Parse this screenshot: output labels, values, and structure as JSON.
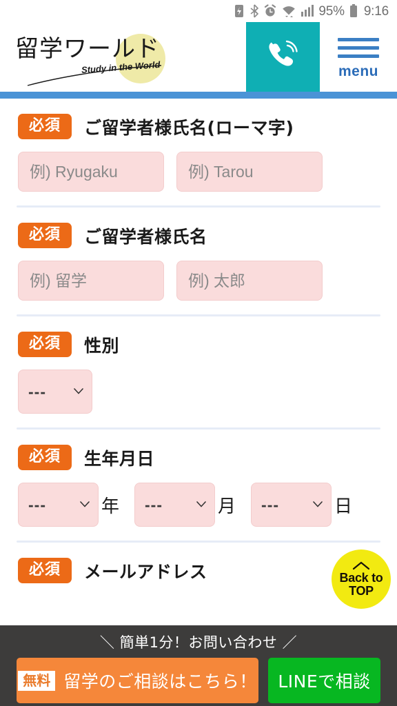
{
  "statusbar": {
    "icons": [
      "battery-saver-icon",
      "bluetooth-icon",
      "alarm-icon",
      "wifi-icon",
      "cellular-signal-icon"
    ],
    "battery_percent": "95%",
    "battery_icon": "battery-icon",
    "time": "9:16"
  },
  "header": {
    "logo_main": "留学ワールド",
    "logo_sub": "Study in the World",
    "phone_icon": "phone-call-icon",
    "menu_icon": "hamburger-menu-icon",
    "menu_label": "menu",
    "accent_teal": "#0fafb4",
    "accent_blue": "#4a93d6",
    "logo_circle_color": "#efeaa8"
  },
  "form": {
    "required_badge": "必須",
    "fields": [
      {
        "id": "name-romaji",
        "title": "ご留学者様氏名(ローマ字)",
        "type": "text-pair",
        "inputs": [
          {
            "name": "last-name-romaji",
            "placeholder": "例) Ryugaku",
            "value": ""
          },
          {
            "name": "first-name-romaji",
            "placeholder": "例) Tarou",
            "value": ""
          }
        ]
      },
      {
        "id": "name-kanji",
        "title": "ご留学者様氏名",
        "type": "text-pair",
        "inputs": [
          {
            "name": "last-name-kanji",
            "placeholder": "例) 留学",
            "value": ""
          },
          {
            "name": "first-name-kanji",
            "placeholder": "例) 太郎",
            "value": ""
          }
        ]
      },
      {
        "id": "gender",
        "title": "性別",
        "type": "select",
        "selects": [
          {
            "name": "gender-select",
            "value": "---",
            "unit": ""
          }
        ]
      },
      {
        "id": "birthdate",
        "title": "生年月日",
        "type": "select-date",
        "selects": [
          {
            "name": "birth-year-select",
            "value": "---",
            "unit": "年"
          },
          {
            "name": "birth-month-select",
            "value": "---",
            "unit": "月"
          },
          {
            "name": "birth-day-select",
            "value": "---",
            "unit": "日"
          }
        ]
      },
      {
        "id": "email",
        "title": "メールアドレス",
        "type": "text",
        "inputs": []
      }
    ],
    "input_bg": "#fadcdc",
    "badge_color": "#ec6a17"
  },
  "back_to_top": {
    "chevron_icon": "chevron-up-icon",
    "line1": "Back to",
    "line2": "TOP",
    "color": "#f2ea11"
  },
  "bottom_bar": {
    "tagline": "＼ 簡単1分！お問い合わせ ／",
    "consult_badge": "無料",
    "consult_label": "留学のご相談はこちら！",
    "line_label": "LINEで相談",
    "consult_color": "#f5873a",
    "line_color": "#07b721"
  }
}
